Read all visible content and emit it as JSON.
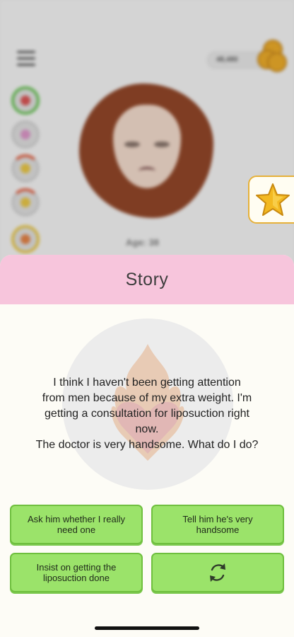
{
  "hud": {
    "coins": "48,480",
    "age": "Age: 38"
  },
  "story": {
    "title": "Story",
    "lines": [
      "I think I haven't been getting attention",
      "from men because of my extra weight. I'm",
      "getting a consultation for liposuction right",
      "now.",
      "The doctor is very handsome. What do I do?"
    ]
  },
  "choices": {
    "ask": [
      "Ask him whether I really",
      "need one"
    ],
    "tell": "Tell him he's very handsome",
    "insist": [
      "Insist on getting the",
      "liposuction done"
    ]
  },
  "icons": {
    "menu": "menu-icon",
    "coins": "coin-stack-icon",
    "star": "star-icon",
    "refresh": "refresh-icon",
    "heart": "flaming-heart-icon"
  },
  "colors": {
    "header_pink": "#f7c5dc",
    "button_green": "#9be36a",
    "star_gold": "#f3b921"
  }
}
